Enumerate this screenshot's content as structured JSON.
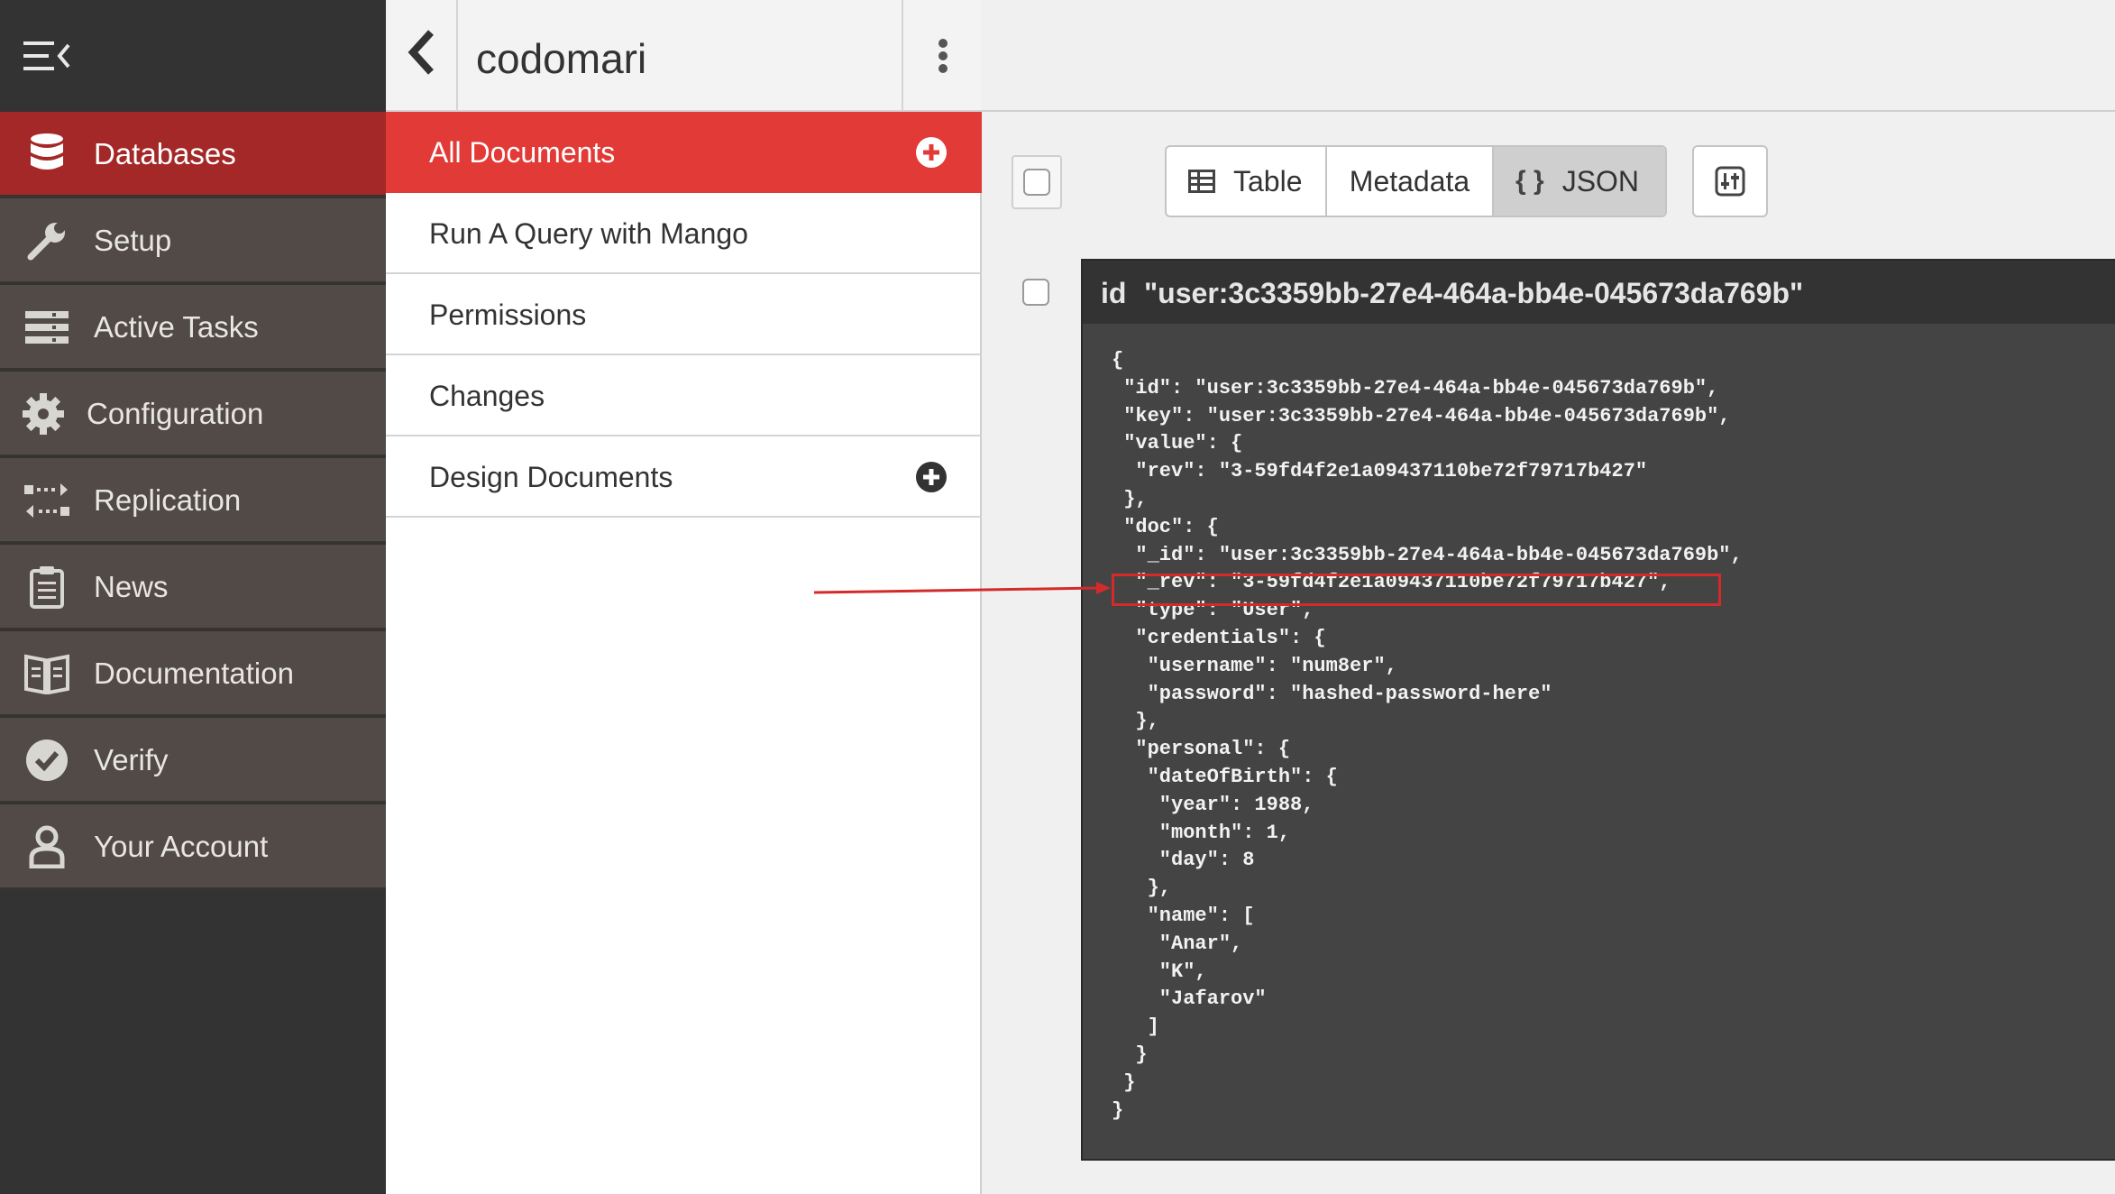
{
  "nav": {
    "items": [
      {
        "label": "Databases",
        "icon": "database-icon"
      },
      {
        "label": "Setup",
        "icon": "wrench-icon"
      },
      {
        "label": "Active Tasks",
        "icon": "tasks-icon"
      },
      {
        "label": "Configuration",
        "icon": "gear-icon"
      },
      {
        "label": "Replication",
        "icon": "replication-icon"
      },
      {
        "label": "News",
        "icon": "clipboard-icon"
      },
      {
        "label": "Documentation",
        "icon": "book-icon"
      },
      {
        "label": "Verify",
        "icon": "check-circle-icon"
      },
      {
        "label": "Your Account",
        "icon": "user-icon"
      }
    ]
  },
  "database": {
    "name": "codomari"
  },
  "sidebar": {
    "items": [
      {
        "label": "All Documents"
      },
      {
        "label": "Run A Query with Mango"
      },
      {
        "label": "Permissions"
      },
      {
        "label": "Changes"
      },
      {
        "label": "Design Documents"
      }
    ]
  },
  "toolbar": {
    "views": [
      {
        "label": "Table",
        "icon": "table-icon"
      },
      {
        "label": "Metadata"
      },
      {
        "label": "JSON",
        "icon": "braces-icon",
        "glyph": "{ }"
      }
    ],
    "active_view": "JSON"
  },
  "document": {
    "id_label": "id",
    "id_value": "\"user:3c3359bb-27e4-464a-bb4e-045673da769b\"",
    "json_lines": [
      "{",
      " \"id\": \"user:3c3359bb-27e4-464a-bb4e-045673da769b\",",
      " \"key\": \"user:3c3359bb-27e4-464a-bb4e-045673da769b\",",
      " \"value\": {",
      "  \"rev\": \"3-59fd4f2e1a09437110be72f79717b427\"",
      " },",
      " \"doc\": {",
      "  \"_id\": \"user:3c3359bb-27e4-464a-bb4e-045673da769b\",",
      "  \"_rev\": \"3-59fd4f2e1a09437110be72f79717b427\",",
      "  \"type\": \"User\",",
      "  \"credentials\": {",
      "   \"username\": \"num8er\",",
      "   \"password\": \"hashed-password-here\"",
      "  },",
      "  \"personal\": {",
      "   \"dateOfBirth\": {",
      "    \"year\": 1988,",
      "    \"month\": 1,",
      "    \"day\": 8",
      "   },",
      "   \"name\": [",
      "    \"Anar\",",
      "    \"K\",",
      "    \"Jafarov\"",
      "   ]",
      "  }",
      " }",
      "}"
    ]
  },
  "colors": {
    "nav_bg": "#333333",
    "nav_item_bg": "#514a46",
    "nav_active": "#a42828",
    "sidebar_active": "#e23a37",
    "annotation_red": "#d42a2a"
  }
}
